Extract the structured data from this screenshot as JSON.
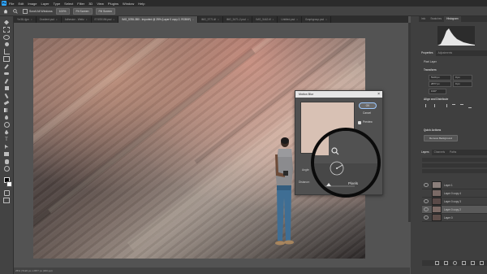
{
  "menu": {
    "logo": "Ps",
    "items": [
      "File",
      "Edit",
      "Image",
      "Layer",
      "Type",
      "Select",
      "Filter",
      "3D",
      "View",
      "Plugins",
      "Window",
      "Help"
    ]
  },
  "options_bar": {
    "sample_all_label": "Scroll All Windows",
    "zoom_value": "100%",
    "fit_screen_label": "Fit Screen",
    "fill_screen_label": "Fill Screen"
  },
  "tabs": [
    {
      "label": "Yrr38-4jpn",
      "active": false
    },
    {
      "label": "Gradient.psd",
      "active": false
    },
    {
      "label": "Adhesion - Weitz",
      "active": false
    },
    {
      "label": "E74S5156.psd",
      "active": false
    },
    {
      "label": "IMG_5785-3B0 - Imported @ 25% (Layer 0 copy 2, RGB/8*)",
      "active": true
    },
    {
      "label": "IMG_9771.tif",
      "active": false
    },
    {
      "label": "IMG_5471-2.psd",
      "active": false
    },
    {
      "label": "IMG_5442.tif",
      "active": false
    },
    {
      "label": "Untitled.psd",
      "active": false
    },
    {
      "label": "Graphgroup.psd",
      "active": false
    }
  ],
  "dialog": {
    "title": "Motion Blur",
    "ok_label": "OK",
    "cancel_label": "Cancel",
    "preview_label": "Preview",
    "angle_label": "Angle:",
    "angle_value": "15",
    "distance_label": "Distance:",
    "distance_unit": "Pixels",
    "zoom_in_icon": "zoom-in-icon",
    "zoom_out_icon": "zoom-out-icon"
  },
  "panels": {
    "top_tabs": [
      "Info",
      "Swatches",
      "Histogram"
    ],
    "prop_tabs": [
      "Properties",
      "Adjustments"
    ],
    "pixel_layer": "Pixel Layer",
    "transform_label": "Transform",
    "w_value": "5120 px",
    "h_value": "2877 px",
    "x_value": "0 px",
    "y_value": "0 px",
    "angle_value": "0.00°",
    "align_label": "Align and Distribute",
    "quick_actions_label": "Quick Actions",
    "remove_bg_label": "Remove Background",
    "layers_tabs": [
      "Layers",
      "Channels",
      "Paths"
    ],
    "layers": [
      {
        "name": "Layer 1",
        "visible": true,
        "selected": false,
        "thumb": "#8b7f7b"
      },
      {
        "name": "Layer 0 copy 4",
        "visible": false,
        "selected": false,
        "thumb": "#7a6a66"
      },
      {
        "name": "Layer 0 copy 3",
        "visible": true,
        "selected": false,
        "thumb": "#5a4a48"
      },
      {
        "name": "Layer 0 copy 2",
        "visible": true,
        "selected": true,
        "thumb": "#7d6b66"
      },
      {
        "name": "Layer 0",
        "visible": true,
        "selected": false,
        "thumb": "#5e4e4a"
      }
    ]
  },
  "status": "25% | 5120 px x 2877 px (300 ppi)",
  "colors": {
    "accent": "#31a8ff",
    "app_bg": "#535353",
    "panel_bg": "#3f3f3f"
  }
}
